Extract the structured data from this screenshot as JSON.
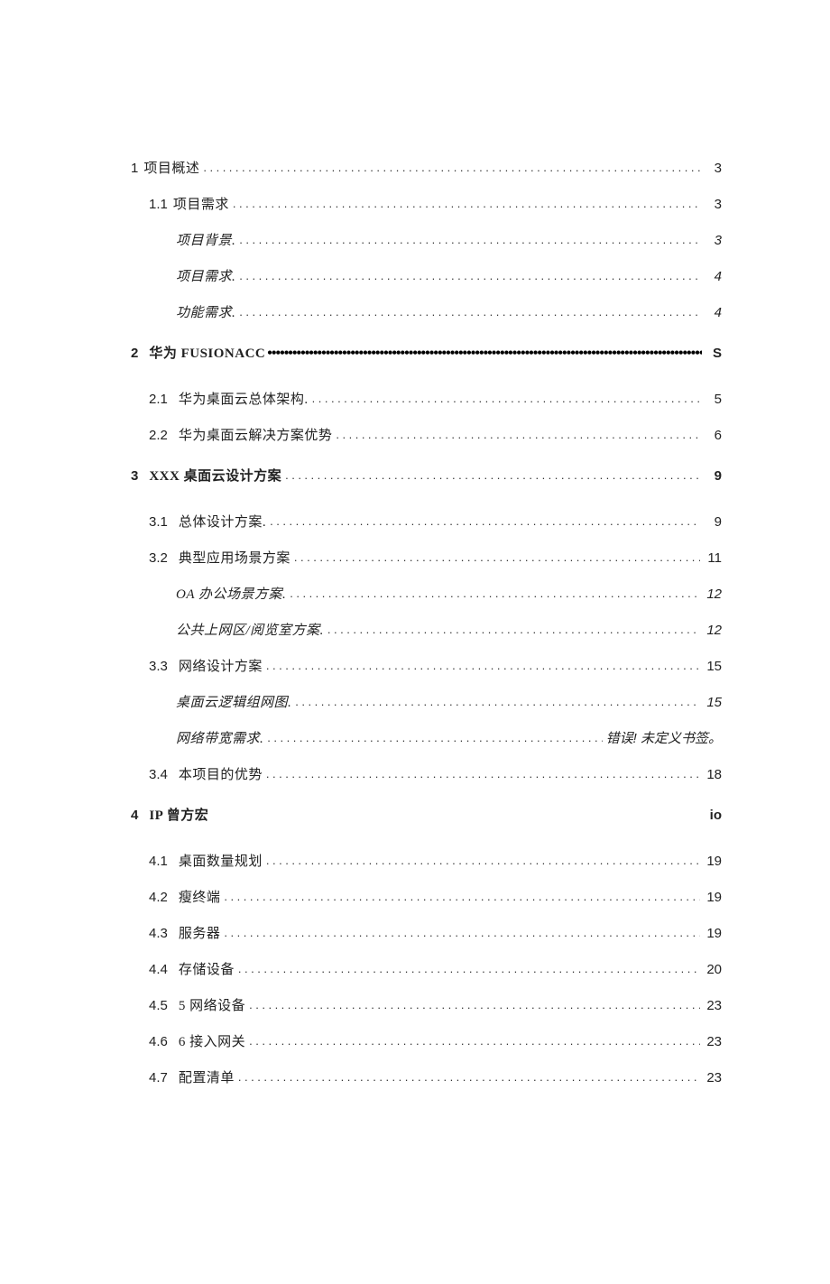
{
  "toc": [
    {
      "indent": "indent-0",
      "style": "plain",
      "num": "1",
      "title": "项目概述",
      "page": "3",
      "leader": "dots",
      "numgap": true
    },
    {
      "indent": "indent-1",
      "style": "plain",
      "num": "1.1",
      "title": "项目需求",
      "page": "3",
      "leader": "dots",
      "numgap": true
    },
    {
      "indent": "indent-2",
      "style": "italic",
      "num": "",
      "title": "项目背景.",
      "page": "3",
      "leader": "dots"
    },
    {
      "indent": "indent-2",
      "style": "italic",
      "num": "",
      "title": "项目需求.",
      "page": "4",
      "leader": "dots"
    },
    {
      "indent": "indent-2",
      "style": "italic",
      "num": "",
      "title": "功能需求.",
      "page": "4",
      "leader": "dots"
    },
    {
      "indent": "indent-0",
      "style": "bold",
      "num": "2",
      "title": "华为 FUSIONACC",
      "page": "S",
      "leader": "tight"
    },
    {
      "indent": "indent-1",
      "style": "plain",
      "num": "2.1",
      "title": "华为桌面云总体架构.",
      "page": "5",
      "leader": "dots"
    },
    {
      "indent": "indent-1",
      "style": "plain",
      "num": "2.2",
      "title": "华为桌面云解决方案优势",
      "page": "6",
      "leader": "dots"
    },
    {
      "indent": "indent-0",
      "style": "bold",
      "num": "3",
      "title": "XXX 桌面云设计方案",
      "page": "9",
      "leader": "dots"
    },
    {
      "indent": "indent-1",
      "style": "plain",
      "num": "3.1",
      "title": "总体设计方案.",
      "page": "9",
      "leader": "dots"
    },
    {
      "indent": "indent-1",
      "style": "plain",
      "num": "3.2",
      "title": "典型应用场景方案",
      "page": "11",
      "leader": "dots"
    },
    {
      "indent": "indent-2",
      "style": "italic",
      "num": "",
      "title": "OA 办公场景方案.",
      "page": "12",
      "leader": "dots"
    },
    {
      "indent": "indent-2",
      "style": "italic",
      "num": "",
      "title": "公共上网区/阅览室方案.",
      "page": "12",
      "leader": "dots"
    },
    {
      "indent": "indent-1",
      "style": "plain",
      "num": "3.3",
      "title": "网络设计方案",
      "page": "15",
      "leader": "dots"
    },
    {
      "indent": "indent-2",
      "style": "italic",
      "num": "",
      "title": "桌面云逻辑组网图.",
      "page": "15",
      "leader": "dots"
    },
    {
      "indent": "indent-2",
      "style": "italic",
      "num": "",
      "title": "网络带宽需求.",
      "page": "错误! 未定义书签。",
      "leader": "dots"
    },
    {
      "indent": "indent-1",
      "style": "plain",
      "num": "3.4",
      "title": "本项目的优势",
      "page": "18",
      "leader": "dots"
    },
    {
      "indent": "indent-0",
      "style": "bold",
      "num": "4",
      "title": "IP 曾方宏",
      "page": "io",
      "leader": "none"
    },
    {
      "indent": "indent-1",
      "style": "plain",
      "num": "4.1",
      "title": "桌面数量规划",
      "page": "19",
      "leader": "dots"
    },
    {
      "indent": "indent-1",
      "style": "plain",
      "num": "4.2",
      "title": "瘦终端",
      "page": "19",
      "leader": "dots"
    },
    {
      "indent": "indent-1",
      "style": "plain",
      "num": "4.3",
      "title": "服务器",
      "page": "19",
      "leader": "dots"
    },
    {
      "indent": "indent-1",
      "style": "plain",
      "num": "4.4",
      "title": "存储设备",
      "page": "20",
      "leader": "dots"
    },
    {
      "indent": "indent-1",
      "style": "plain",
      "num": "4.5",
      "title": "5 网络设备",
      "page": "23",
      "leader": "dots"
    },
    {
      "indent": "indent-1",
      "style": "plain",
      "num": "4.6",
      "title": "6 接入网关",
      "page": "23",
      "leader": "dots"
    },
    {
      "indent": "indent-1",
      "style": "plain",
      "num": "4.7",
      "title": "配置清单",
      "page": "23",
      "leader": "dots"
    }
  ]
}
